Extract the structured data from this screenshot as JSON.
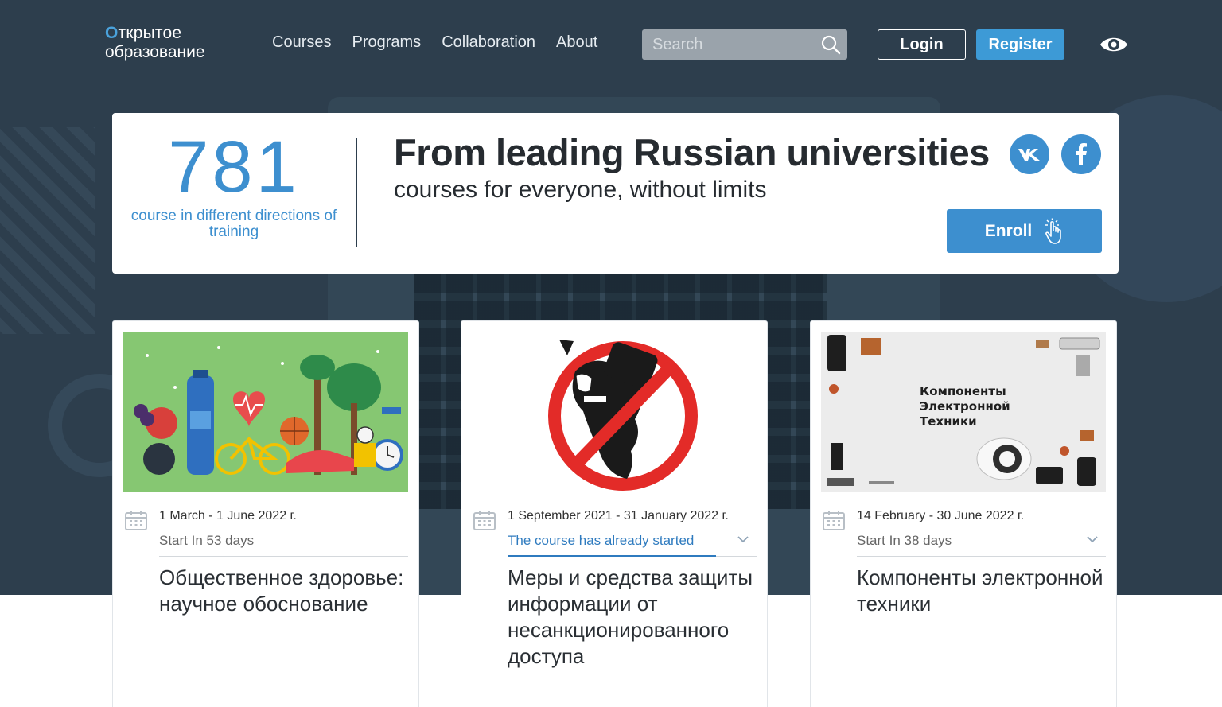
{
  "header": {
    "logo_line1_initial": "О",
    "logo_line1_rest": "ткрытое",
    "logo_line2": "образование",
    "nav": [
      "Courses",
      "Programs",
      "Collaboration",
      "About"
    ],
    "search_placeholder": "Search",
    "login_label": "Login",
    "register_label": "Register"
  },
  "promo": {
    "count": "781",
    "count_caption": "course in different directions of training",
    "headline": "From leading Russian universities",
    "subline": "courses for everyone, without limits",
    "enroll_label": "Enroll",
    "social": [
      "vk-icon",
      "facebook-icon"
    ]
  },
  "courses": [
    {
      "dates": "1 March - 1 June 2022 г.",
      "status": "Start In 53 days",
      "title": "Общественное здоровье: научное обоснование"
    },
    {
      "dates": "1 September 2021 - 31 January 2022 г.",
      "status": "The course has already started",
      "title": "Меры и средства защиты информации от несанкционированного доступа"
    },
    {
      "dates": "14 February - 30 June 2022 г.",
      "status": "Start In 38 days",
      "title": "Компоненты электронной техники",
      "thumb_text": [
        "Компоненты",
        "Электронной",
        "Техники"
      ]
    }
  ],
  "colors": {
    "hero_bg": "#2d3e4d",
    "accent": "#3d8fcf",
    "register_bg": "#3d9ad6",
    "link_blue": "#2f7bbf"
  }
}
